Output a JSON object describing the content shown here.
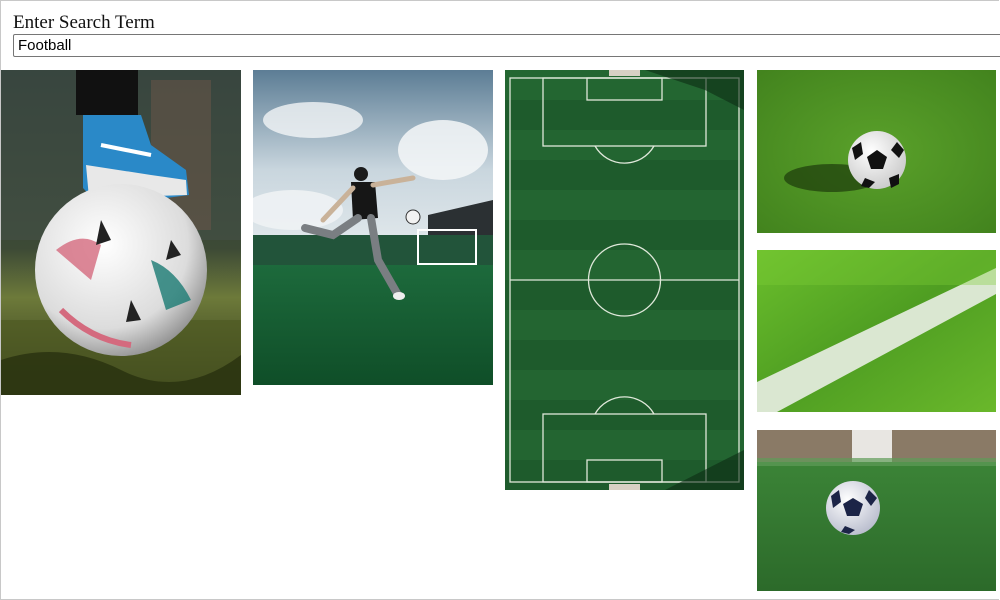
{
  "search": {
    "label": "Enter Search Term",
    "value": "Football"
  },
  "gallery": {
    "images": [
      {
        "subject": "player foot on ball"
      },
      {
        "subject": "player kicking ball"
      },
      {
        "subject": "aerial football pitch"
      },
      {
        "subject": "ball on grass"
      },
      {
        "subject": "white line on grass"
      },
      {
        "subject": "ball on artificial turf"
      }
    ]
  },
  "colors": {
    "grass_dark": "#1f5e2c",
    "grass_light": "#58a82a",
    "border": "#767676"
  }
}
